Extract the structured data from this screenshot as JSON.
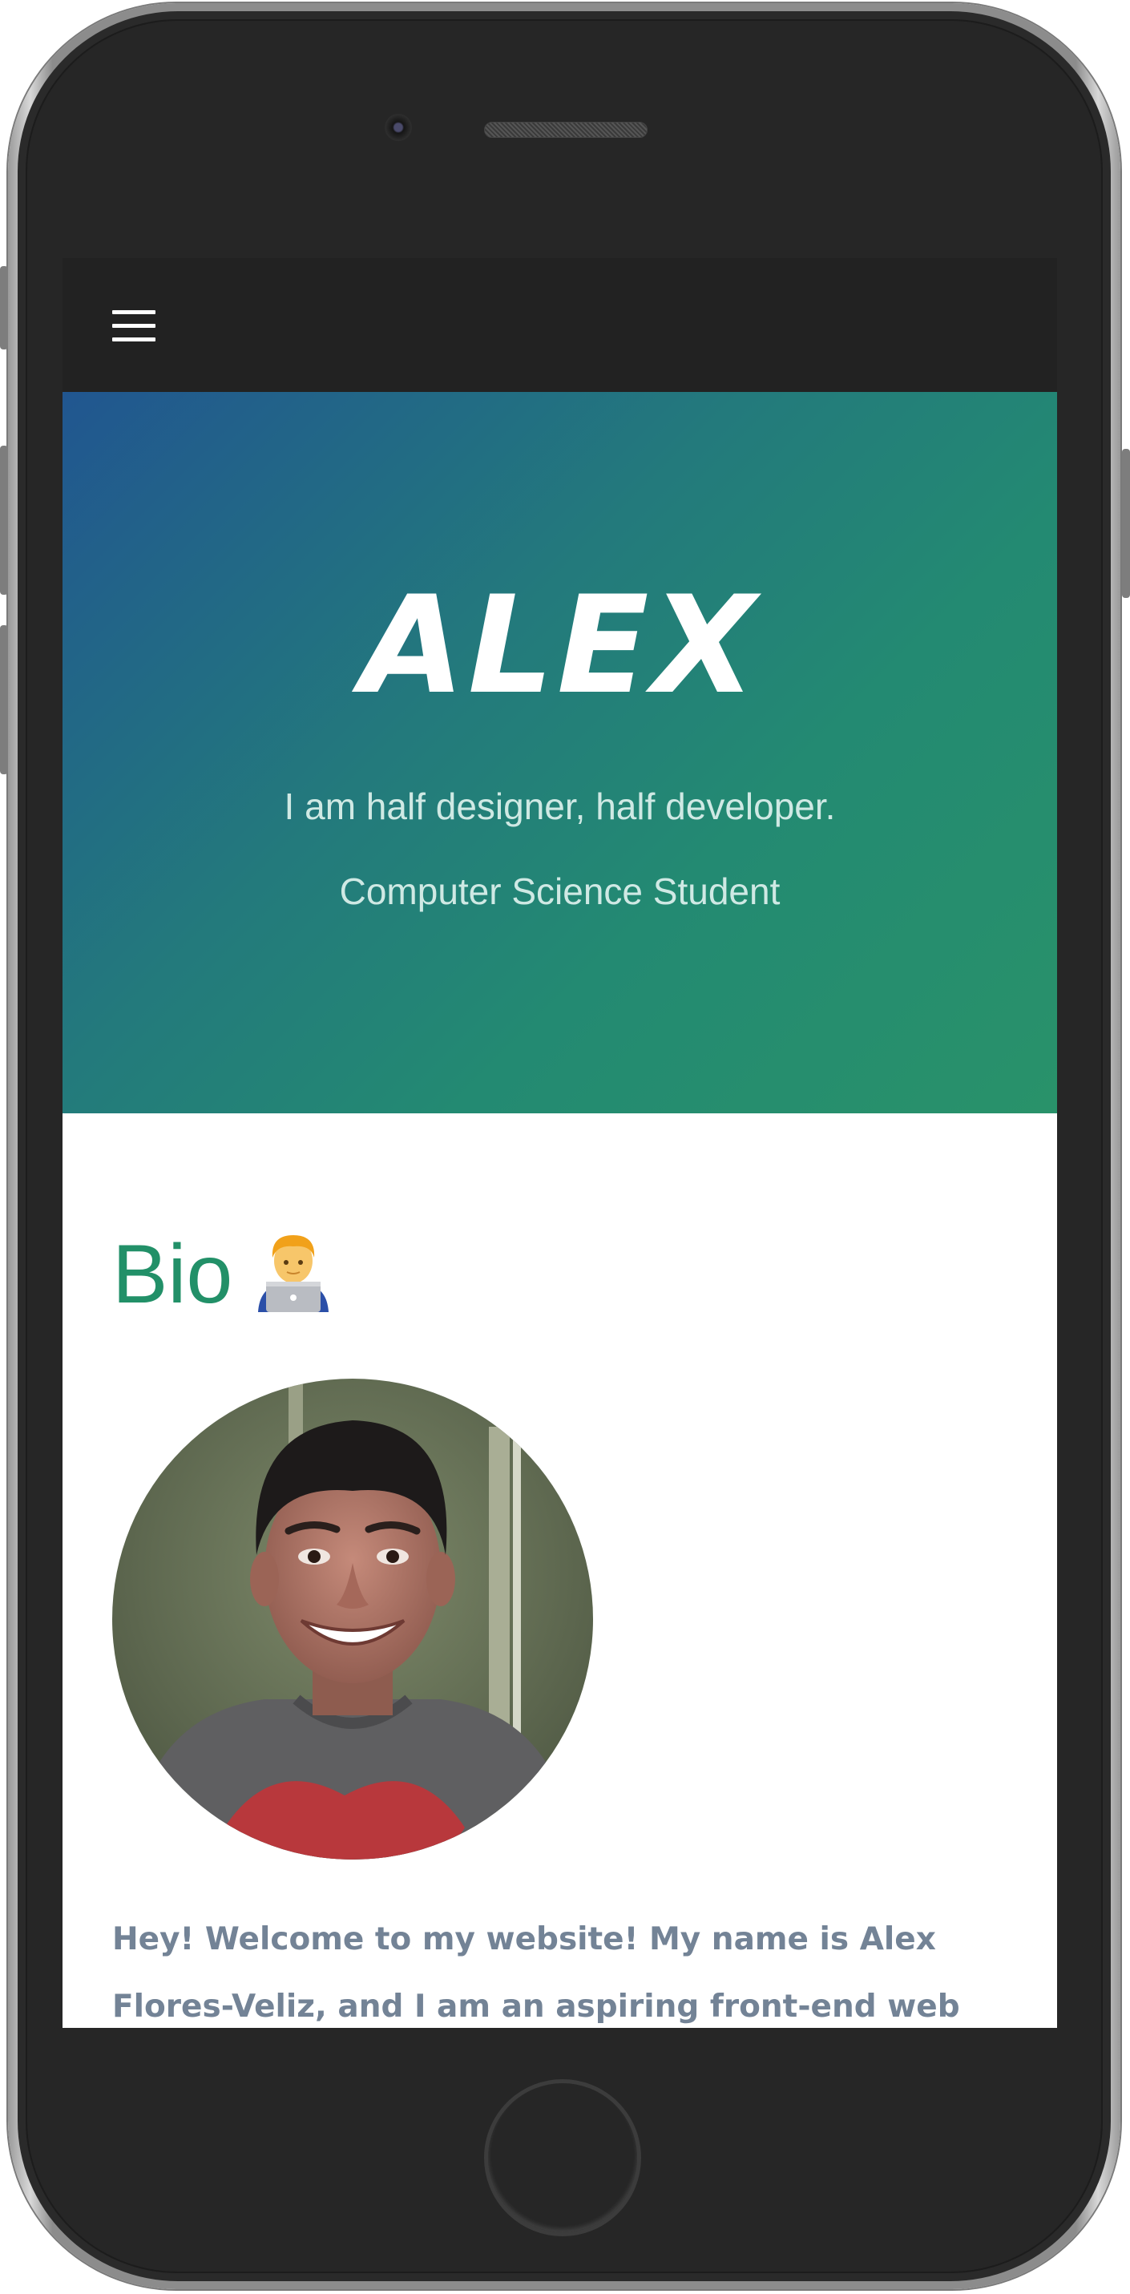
{
  "navbar": {
    "menu_icon": "hamburger-menu-icon"
  },
  "hero": {
    "title": "ALEX",
    "line1": "I am half designer, half developer.",
    "line2": "Computer Science Student"
  },
  "bio": {
    "heading": "Bio",
    "heading_icon": "technologist-with-laptop-emoji",
    "photo": "portrait-photo",
    "text": "Hey! Welcome to my website! My name is Alex Flores-Veliz, and I am an aspiring front-end web developer"
  },
  "colors": {
    "navbar_bg": "#222222",
    "hero_gradient_start": "#215690",
    "hero_gradient_end": "#29926a",
    "bio_heading": "#229068",
    "bio_text": "#738396",
    "hero_subtext": "#cfe9e4"
  }
}
